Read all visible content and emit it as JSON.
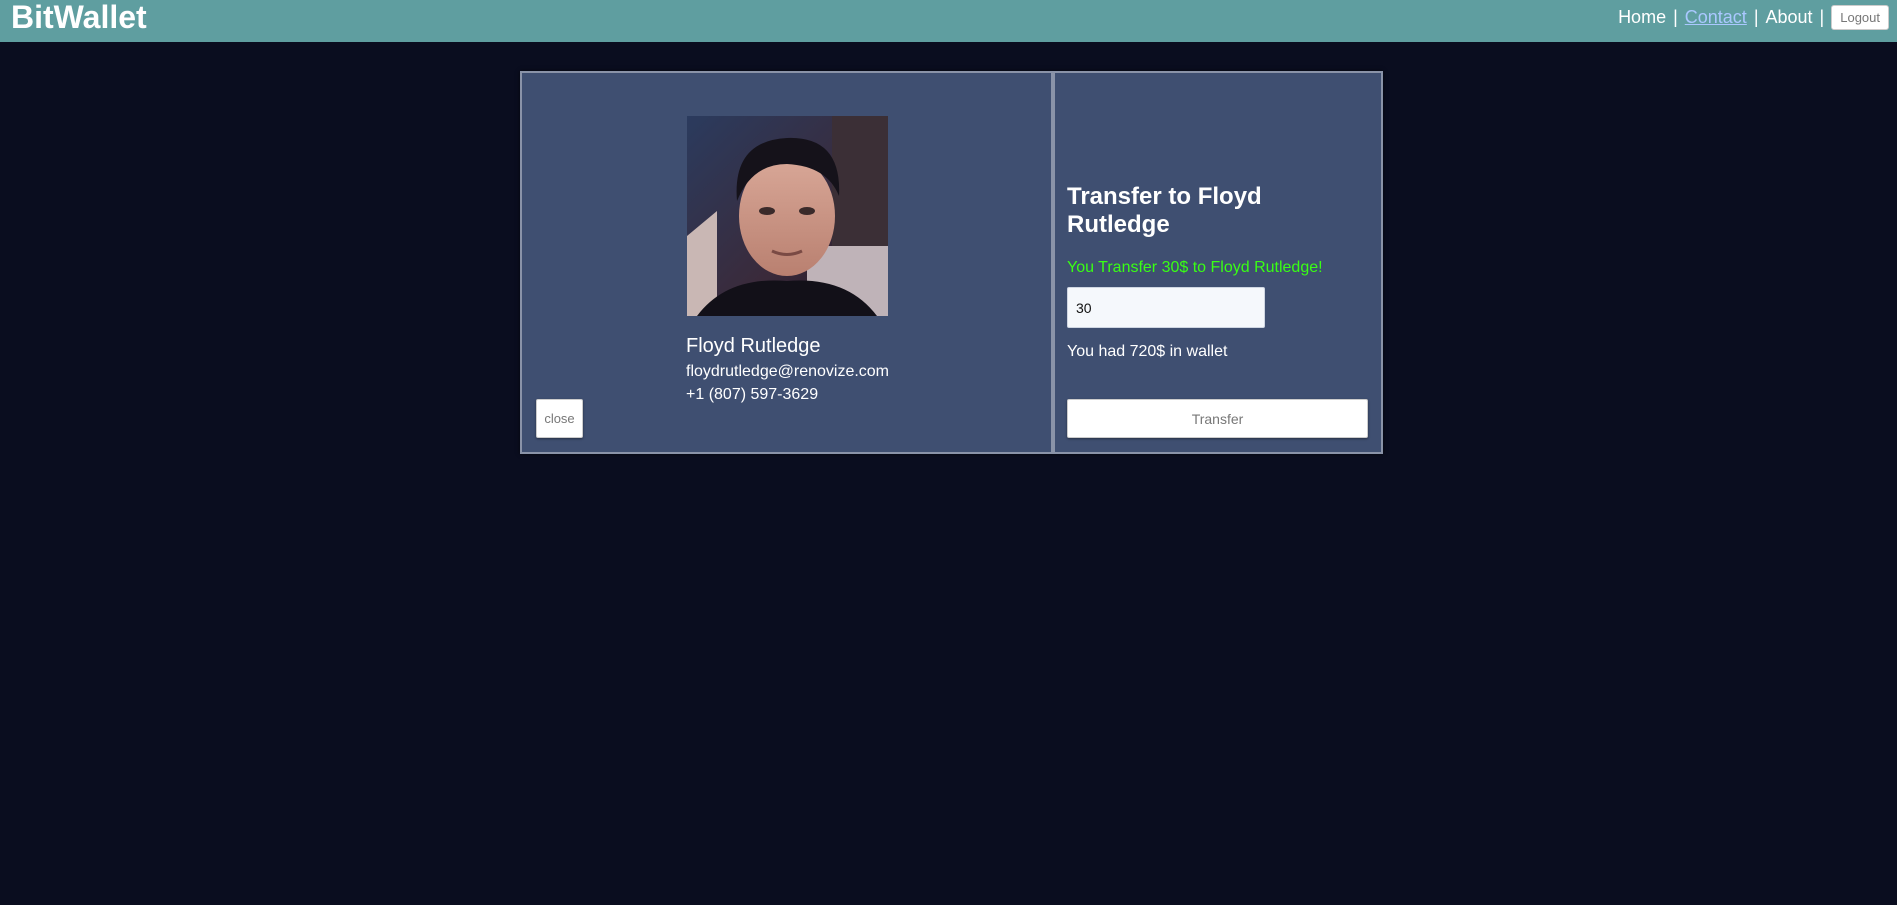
{
  "app": {
    "brand": "BitWallet"
  },
  "nav": {
    "home": "Home",
    "contact": "Contact",
    "about": "About",
    "separator": "|",
    "logout": "Logout"
  },
  "contact": {
    "name": "Floyd Rutledge",
    "email": "floydrutledge@renovize.com",
    "phone": "+1 (807) 597-3629"
  },
  "actions": {
    "close": "close",
    "transfer": "Transfer"
  },
  "transfer": {
    "title": "Transfer to Floyd Rutledge",
    "success_message": "You Transfer 30$ to Floyd Rutledge!",
    "amount_value": "30",
    "wallet_message": "You had 720$ in wallet"
  },
  "colors": {
    "topbar": "#5f9ea0",
    "background": "#0a0d1f",
    "card": "#3f4f71",
    "success": "#39ff14"
  }
}
